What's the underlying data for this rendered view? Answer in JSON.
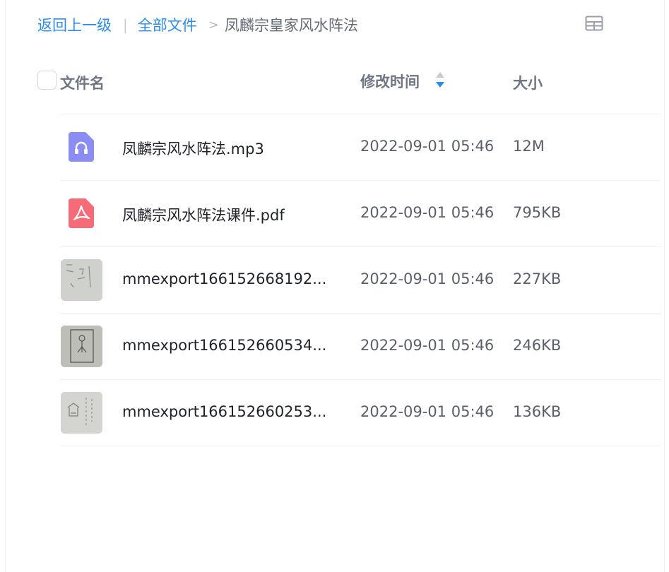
{
  "breadcrumb": {
    "back": "返回上一级",
    "separator": "|",
    "root": "全部文件",
    "arrow": ">",
    "current": "凤麟宗皇家风水阵法"
  },
  "table": {
    "columns": {
      "name": "文件名",
      "modified": "修改时间",
      "size": "大小"
    },
    "rows": [
      {
        "name": "凤麟宗风水阵法.mp3",
        "modified": "2022-09-01 05:46",
        "size": "12M",
        "icon": "audio-file-icon"
      },
      {
        "name": "凤麟宗风水阵法课件.pdf",
        "modified": "2022-09-01 05:46",
        "size": "795KB",
        "icon": "pdf-file-icon"
      },
      {
        "name": "mmexport166152668192...",
        "modified": "2022-09-01 05:46",
        "size": "227KB",
        "icon": "image-thumbnail"
      },
      {
        "name": "mmexport166152660534...",
        "modified": "2022-09-01 05:46",
        "size": "246KB",
        "icon": "image-thumbnail"
      },
      {
        "name": "mmexport166152660253...",
        "modified": "2022-09-01 05:46",
        "size": "136KB",
        "icon": "image-thumbnail"
      }
    ]
  },
  "colors": {
    "link": "#2e8ce6",
    "audio_icon": "#8b8cf4",
    "pdf_icon": "#f66b78",
    "sort_active": "#2e8ce6"
  }
}
